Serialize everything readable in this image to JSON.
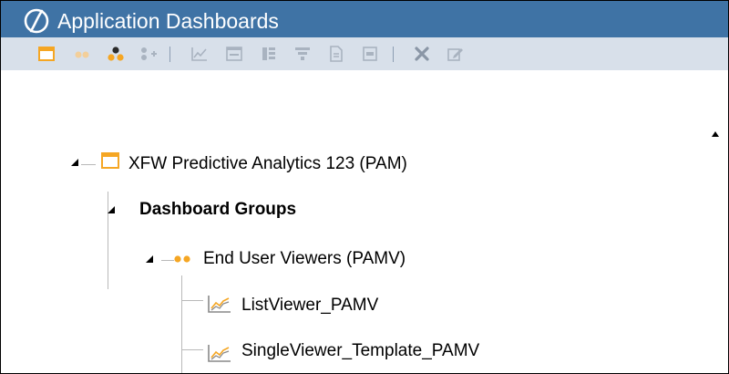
{
  "window": {
    "title": "Application Dashboards",
    "titlebar_color": "#3f73a5",
    "toolbar_color": "#d8e0ea"
  },
  "toolbar": {
    "buttons": [
      {
        "icon": "dashboard-calendar-icon",
        "enabled": true
      },
      {
        "icon": "two-dots-group-icon",
        "enabled": false
      },
      {
        "icon": "three-dots-group-icon",
        "enabled": true
      },
      {
        "icon": "add-group-icon",
        "enabled": false
      },
      {
        "icon": "line-chart-icon",
        "enabled": false
      },
      {
        "icon": "window-icon",
        "enabled": false
      },
      {
        "icon": "columns-icon",
        "enabled": false
      },
      {
        "icon": "filter-icon",
        "enabled": false
      },
      {
        "icon": "document-icon",
        "enabled": false
      },
      {
        "icon": "component-icon",
        "enabled": false
      },
      {
        "icon": "delete-icon",
        "enabled": false
      },
      {
        "icon": "edit-icon",
        "enabled": false
      }
    ]
  },
  "tree": {
    "maintenance_unit": {
      "label": "XFW Predictive Analytics 123 (PAM)",
      "icon": "dashboard-calendar-icon",
      "expanded": true
    },
    "dashboard_groups": {
      "label": "Dashboard Groups",
      "expanded": true
    },
    "group": {
      "label": "End User Viewers (PAMV)",
      "icon": "two-dots-group-icon",
      "expanded": true
    },
    "dashboards": [
      {
        "label": "ListViewer_PAMV",
        "icon": "line-chart-icon"
      },
      {
        "label": "SingleViewer_Template_PAMV",
        "icon": "line-chart-icon"
      }
    ]
  },
  "colors": {
    "accent_orange": "#f5a623",
    "icon_gray": "#a9b3c0",
    "tree_line": "#b9b9b9"
  }
}
